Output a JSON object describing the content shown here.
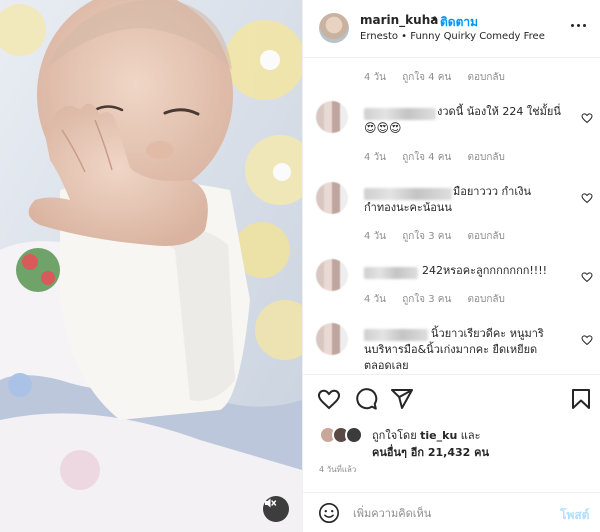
{
  "post": {
    "username": "marin_kuha",
    "separator": "•",
    "follow_label": "ติดตาม",
    "audio": "Ernesto • Funny Quirky Comedy Free"
  },
  "comments": [
    {
      "text": "",
      "age": "4 วัน",
      "likes": "ถูกใจ 4 คน",
      "reply": "ตอบกลับ",
      "has_avatar": false
    },
    {
      "text": "งวดนี้ น้องให้ 224 ใช่มั้ยนี่",
      "emoji": "😍😍😍",
      "age": "4 วัน",
      "likes": "ถูกใจ 4 คน",
      "reply": "ตอบกลับ"
    },
    {
      "text": "มือยาววว กำเงิน",
      "text2": "กำทองนะคะน้อนน",
      "age": "4 วัน",
      "likes": "ถูกใจ 3 คน",
      "reply": "ตอบกลับ"
    },
    {
      "text": "242หรอคะลูกกกกกกก!!!!",
      "age": "4 วัน",
      "likes": "ถูกใจ 3 คน",
      "reply": "ตอบกลับ"
    },
    {
      "text": "นิ้วยาวเรียวดีคะ หนูมาริ",
      "text2": "นบริหารมือ&นิ้วเก่งมากคะ ยืดเหยียด",
      "text3": "ตลอดเลย"
    }
  ],
  "likes": {
    "liked_by_prefix": "ถูกใจโดย",
    "liked_by_user": "tie_ku",
    "liked_by_suffix": "และ",
    "others_label": "คนอื่นๆ อีก 21,432 คน"
  },
  "time_ago": "4 วันที่แล้ว",
  "comment_box": {
    "placeholder": "เพิ่มความคิดเห็น",
    "post_label": "โพสต์"
  },
  "icons": {
    "like": "heart-icon",
    "comment": "comment-icon",
    "share": "paper-plane-icon",
    "save": "bookmark-icon",
    "emoji": "smiley-icon",
    "mute": "speaker-muted-icon",
    "more": "ellipsis-icon"
  },
  "colors": {
    "follow": "#0095f6",
    "post_disabled": "#b2dffc",
    "muted_text": "#8e8e8e"
  }
}
